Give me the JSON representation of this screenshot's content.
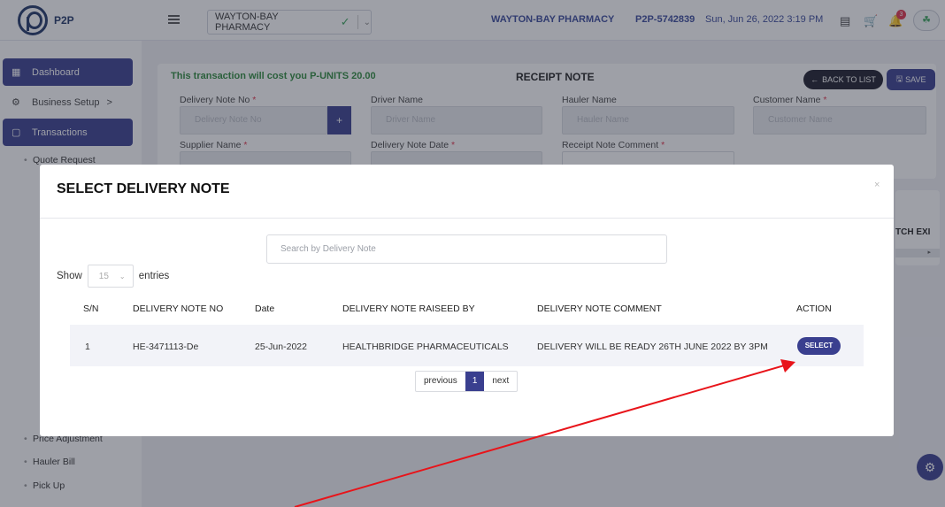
{
  "header": {
    "logo_text": "P2P",
    "store_selector_value": "WAYTON-BAY PHARMACY",
    "pharmacy_name": "WAYTON-BAY PHARMACY",
    "account_code": "P2P-5742839",
    "datetime": "Sun, Jun 26, 2022 3:19 PM",
    "notification_count": "3"
  },
  "sidebar": {
    "items": [
      {
        "label": "Dashboard",
        "icon": "grid-icon"
      },
      {
        "label": "Business Setup",
        "icon": "gear-icon"
      },
      {
        "label": "Transactions",
        "icon": "document-icon"
      }
    ],
    "business_setup_chevron": ">",
    "sub_items": [
      "Quote Request",
      "Price Adjustment",
      "Hauler Bill",
      "Pick Up"
    ]
  },
  "page": {
    "cost_notice": "This transaction will cost you P-UNITS 20.00",
    "title": "RECEIPT NOTE",
    "back_label": "BACK TO LIST",
    "save_label": "SAVE",
    "fields": {
      "delivery_note_no": {
        "label": "Delivery Note No",
        "placeholder": "Delivery Note No"
      },
      "driver_name": {
        "label": "Driver Name",
        "placeholder": "Driver Name"
      },
      "hauler_name": {
        "label": "Hauler Name",
        "placeholder": "Hauler Name"
      },
      "customer_name": {
        "label": "Customer Name",
        "placeholder": "Customer Name"
      },
      "supplier_name": {
        "label": "Supplier Name"
      },
      "delivery_note_date": {
        "label": "Delivery Note Date"
      },
      "receipt_note_comment": {
        "label": "Receipt Note Comment"
      }
    },
    "right_card_text": "TCH EXI"
  },
  "modal": {
    "title": "SELECT DELIVERY NOTE",
    "close_glyph": "×",
    "search_placeholder": "Search by Delivery Note",
    "show_label": "Show",
    "entries_value": "15",
    "entries_label": "entries",
    "columns": [
      "S/N",
      "DELIVERY NOTE NO",
      "Date",
      "DELIVERY NOTE RAISEED BY",
      "DELIVERY NOTE COMMENT",
      "ACTION"
    ],
    "rows": [
      {
        "sn": "1",
        "delivery_note_no": "HE-3471113-De",
        "date": "25-Jun-2022",
        "raised_by": "HEALTHBRIDGE PHARMACEUTICALS",
        "comment": "DELIVERY WILL BE READY 26TH JUNE 2022 BY 3PM",
        "action": "SELECT"
      }
    ],
    "pagination": {
      "previous": "previous",
      "current": "1",
      "next": "next"
    }
  },
  "colors": {
    "primary": "#3a3f8f",
    "success_text": "#2e8b3c",
    "annotation_arrow": "#e8141a"
  }
}
